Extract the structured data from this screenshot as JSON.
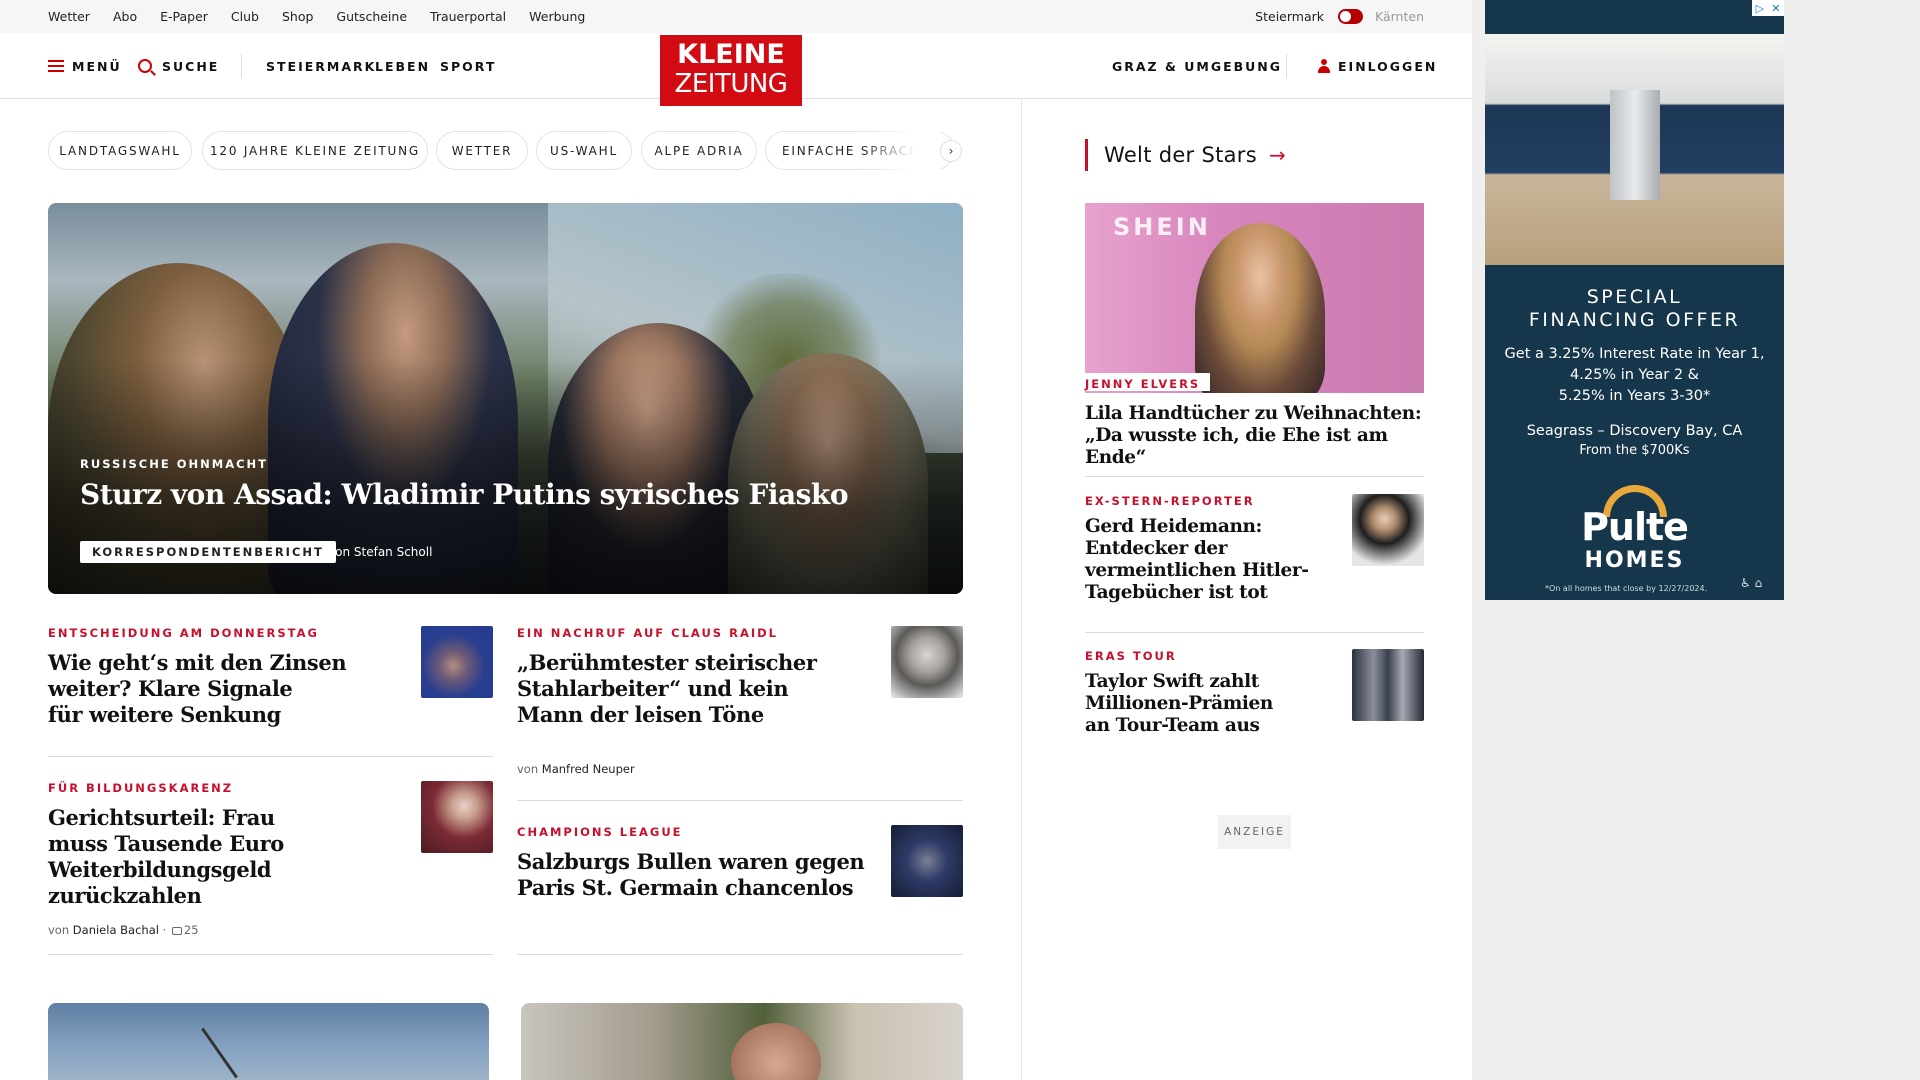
{
  "utility_links": [
    "Wetter",
    "Abo",
    "E-Paper",
    "Club",
    "Shop",
    "Gutscheine",
    "Trauerportal",
    "Werbung"
  ],
  "region": {
    "active": "Steiermark",
    "inactive": "Kärnten"
  },
  "nav": {
    "menu": "MENÜ",
    "search": "SUCHE",
    "sections": [
      "STEIERMARK",
      "LEBEN",
      "SPORT"
    ],
    "local": "GRAZ & UMGEBUNG",
    "login": "EINLOGGEN"
  },
  "logo": {
    "line1": "KLEINE",
    "line2": "ZEITUNG"
  },
  "chips": [
    "LANDTAGSWAHL",
    "120 JAHRE KLEINE ZEITUNG",
    "WETTER",
    "US-WAHL",
    "ALPE ADRIA",
    "EINFACHE SPRACHE"
  ],
  "hero": {
    "kicker": "RUSSISCHE OHNMACHT",
    "title": "Sturz von Assad: Wladimir Putins syrisches Fiasko",
    "badge": "KORRESPONDENTENBERICHT",
    "by_prefix": "von",
    "author": "Stefan Scholl"
  },
  "teasers": {
    "t1": {
      "kicker": "ENTSCHEIDUNG AM DONNERSTAG",
      "l1": "Wie geht‘s mit den Zinsen",
      "l2": "weiter? Klare Signale",
      "l3": "für weitere Senkung"
    },
    "t2": {
      "kicker": "EIN NACHRUF AUF CLAUS RAIDL",
      "l1": "„Berühmtester steirischer",
      "l2": "Stahlarbeiter“ und kein",
      "l3": "Mann der leisen Töne",
      "by_prefix": "von",
      "author": "Manfred Neuper"
    },
    "t3": {
      "kicker": "FÜR BILDUNGSKARENZ",
      "l1": "Gerichtsurteil: Frau",
      "l2": "muss Tausende Euro",
      "l3": "Weiterbildungsgeld",
      "l4": "zurückzahlen",
      "by_prefix": "von",
      "author": "Daniela Bachal",
      "comments": "25"
    },
    "t4": {
      "kicker": "CHAMPIONS LEAGUE",
      "l1": "Salzburgs Bullen waren gegen",
      "l2": "Paris St. Germain chancenlos"
    }
  },
  "right": {
    "section_title": "Welt der Stars",
    "feature": {
      "img_text": "SHEIN",
      "kicker": "JENNY ELVERS",
      "l1": "Lila Handtücher zu Weihnachten:",
      "l2": "„Da wusste ich, die Ehe ist am Ende“"
    },
    "r1": {
      "kicker": "EX-STERN-REPORTER",
      "l1": "Gerd Heidemann:",
      "l2": "Entdecker der",
      "l3": "vermeintlichen Hitler-",
      "l4": "Tagebücher ist tot"
    },
    "r2": {
      "kicker": "ERAS TOUR",
      "l1": "Taylor Swift zahlt",
      "l2": "Millionen-Prämien",
      "l3": "an Tour-Team aus"
    },
    "anzeige": "ANZEIGE"
  },
  "ad": {
    "headline1": "SPECIAL",
    "headline2": "FINANCING OFFER",
    "b1": "Get a 3.25% Interest Rate in Year 1,",
    "b2": "4.25% in Year 2 &",
    "b3": "5.25% in Years 3-30*",
    "loc1": "Seagrass – Discovery Bay, CA",
    "loc2": "From the $700Ks",
    "brand1": "Pulte",
    "brand2": "HOMES",
    "fine": "*On all homes that close by 12/27/2024."
  },
  "colors": {
    "brand_red": "#d20a11",
    "kicker_red": "#c8102e",
    "ad_navy": "#16364b"
  }
}
